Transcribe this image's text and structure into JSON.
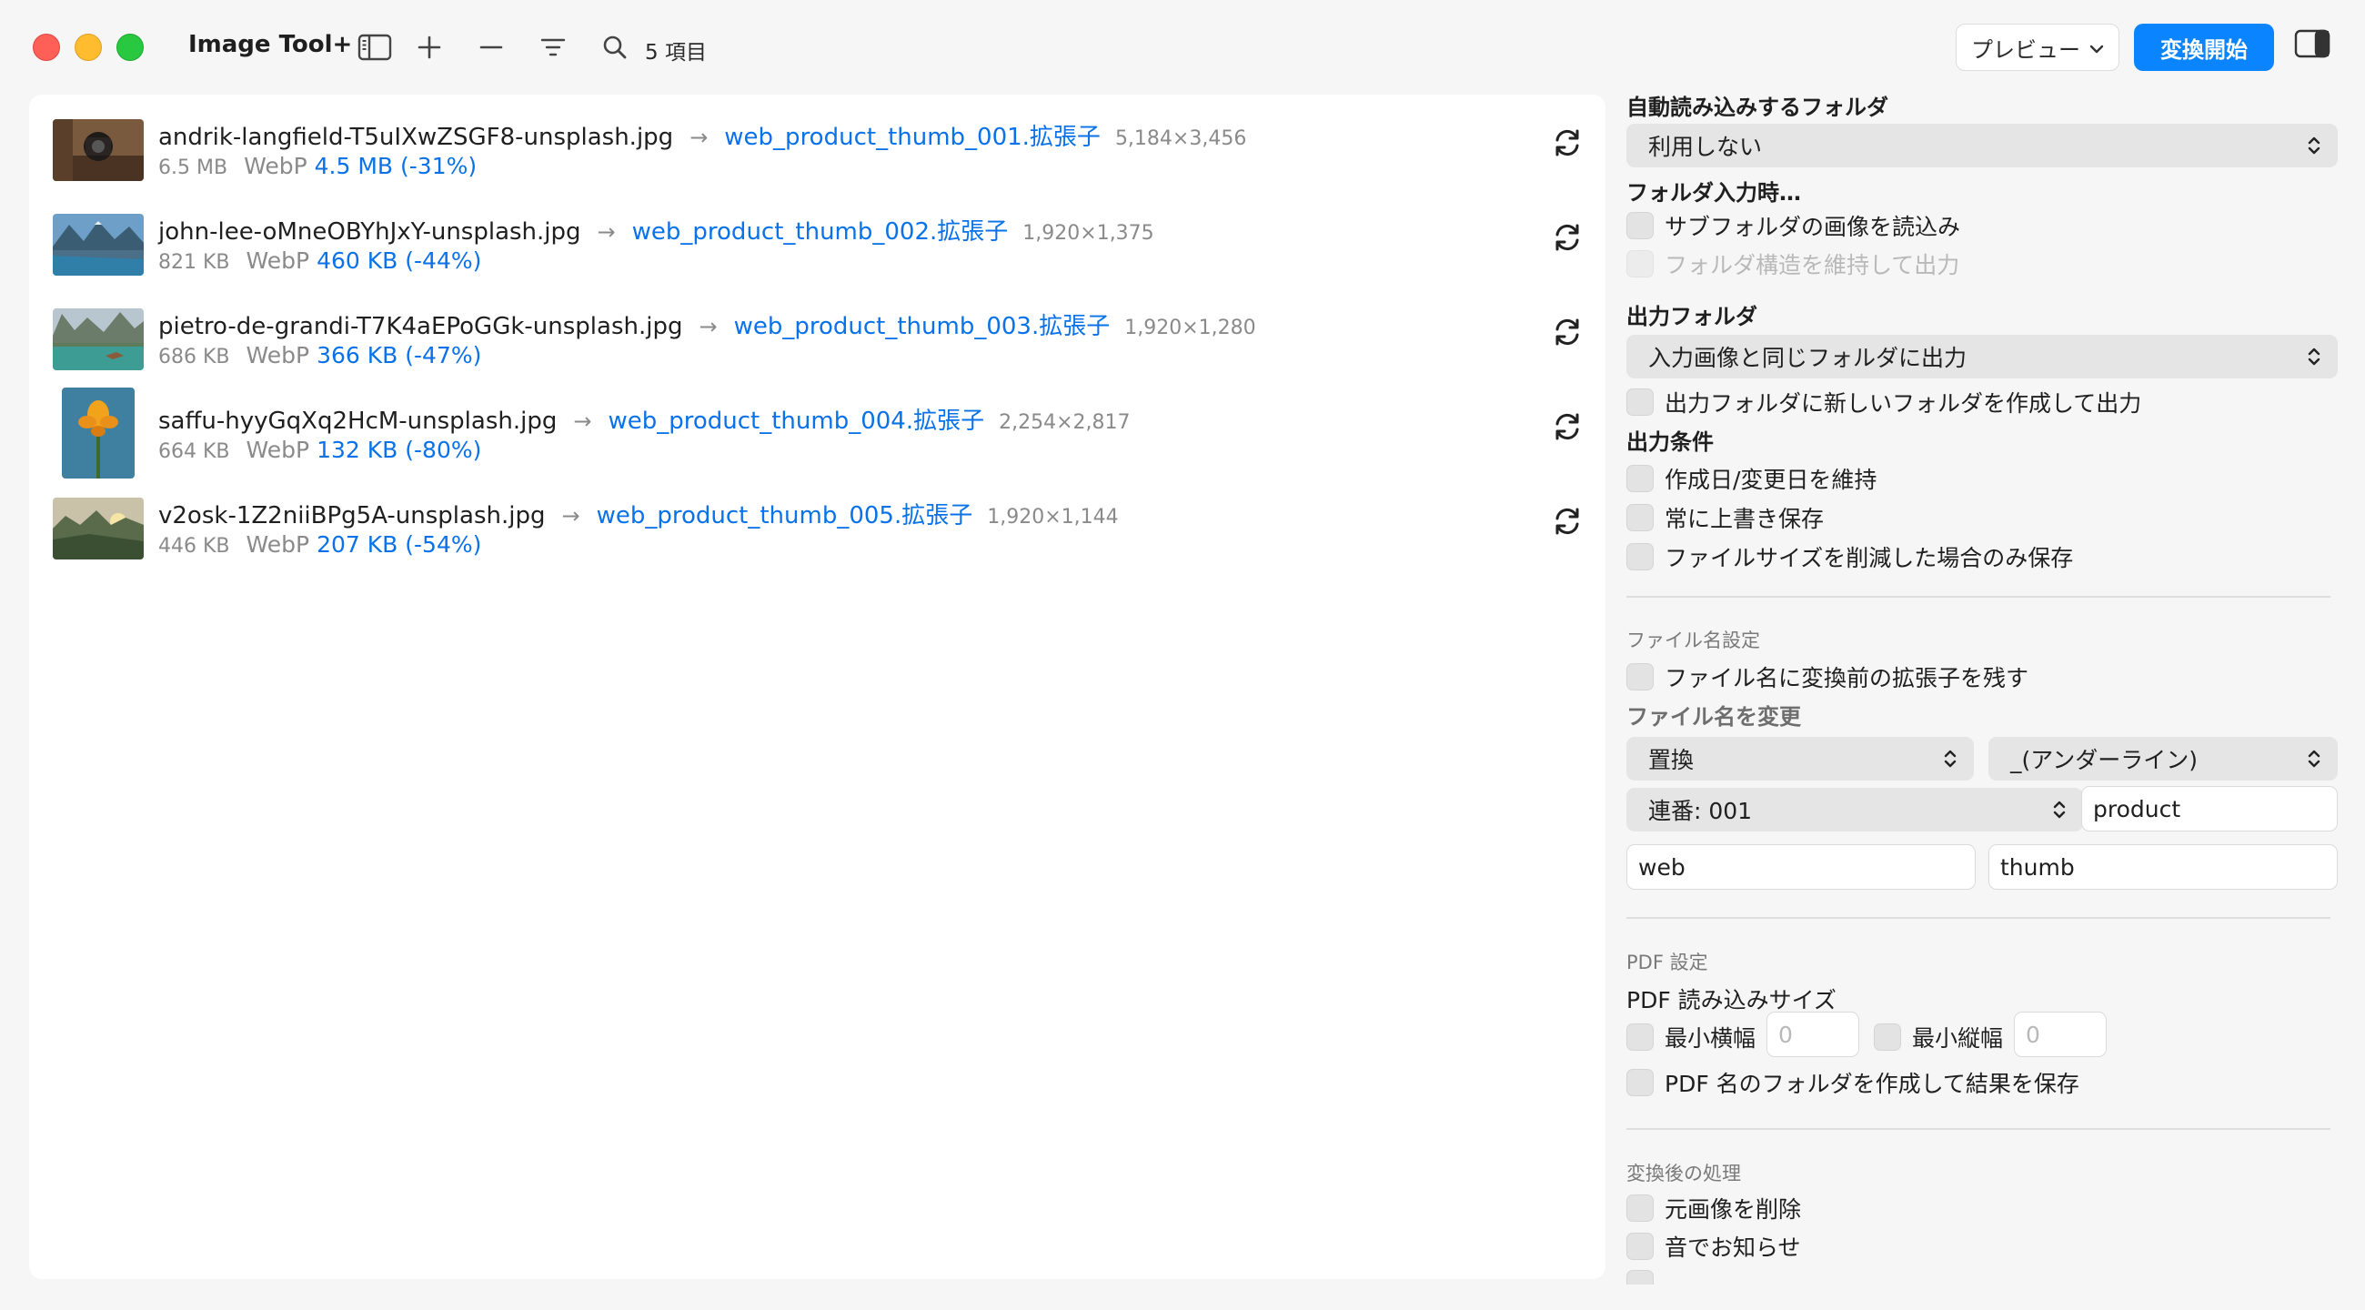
{
  "window": {
    "app_title": "Image Tool+",
    "item_count": "5 項目",
    "preview_label": "プレビュー",
    "convert_label": "変換開始",
    "accent_color": "#0a84ff"
  },
  "toolbar_icons": [
    "sidebar-icon",
    "plus-icon",
    "minus-icon",
    "filter-icon",
    "search-icon"
  ],
  "files": [
    {
      "source": "andrik-langfield-T5uIXwZSGF8-unsplash.jpg",
      "output": "web_product_thumb_001.拡張子",
      "dimensions": "5,184×3,456",
      "source_size": "6.5 MB",
      "format": "WebP",
      "output_size": "4.5 MB (-31%)"
    },
    {
      "source": "john-lee-oMneOBYhJxY-unsplash.jpg",
      "output": "web_product_thumb_002.拡張子",
      "dimensions": "1,920×1,375",
      "source_size": "821 KB",
      "format": "WebP",
      "output_size": "460 KB (-44%)"
    },
    {
      "source": "pietro-de-grandi-T7K4aEPoGGk-unsplash.jpg",
      "output": "web_product_thumb_003.拡張子",
      "dimensions": "1,920×1,280",
      "source_size": "686 KB",
      "format": "WebP",
      "output_size": "366 KB (-47%)"
    },
    {
      "source": "saffu-hyyGqXq2HcM-unsplash.jpg",
      "output": "web_product_thumb_004.拡張子",
      "dimensions": "2,254×2,817",
      "source_size": "664 KB",
      "format": "WebP",
      "output_size": "132 KB (-80%)"
    },
    {
      "source": "v2osk-1Z2niiBPg5A-unsplash.jpg",
      "output": "web_product_thumb_005.拡張子",
      "dimensions": "1,920×1,144",
      "source_size": "446 KB",
      "format": "WebP",
      "output_size": "207 KB (-54%)"
    }
  ],
  "settings": {
    "auto_folder": {
      "heading": "自動読み込みするフォルダ",
      "value": "利用しない"
    },
    "folder_input": {
      "heading": "フォルダ入力時…",
      "subfolders": "サブフォルダの画像を読込み",
      "keep_structure": "フォルダ構造を維持して出力"
    },
    "output_folder": {
      "heading": "出力フォルダ",
      "value": "入力画像と同じフォルダに出力",
      "new_folder": "出力フォルダに新しいフォルダを作成して出力"
    },
    "output_conditions": {
      "heading": "出力条件",
      "keep_dates": "作成日/変更日を維持",
      "always_overwrite": "常に上書き保存",
      "save_if_smaller": "ファイルサイズを削減した場合のみ保存"
    },
    "filename": {
      "subheading": "ファイル名設定",
      "keep_ext": "ファイル名に変換前の拡張子を残す",
      "rename_heading": "ファイル名を変更",
      "mode": "置換",
      "separator": "_(アンダーライン)",
      "sequence": "連番: 001",
      "text1": "product",
      "text2": "web",
      "text3": "thumb"
    },
    "pdf": {
      "subheading": "PDF 設定",
      "size_heading": "PDF 読み込みサイズ",
      "min_width_label": "最小横幅",
      "min_width_placeholder": "0",
      "min_height_label": "最小縦幅",
      "min_height_placeholder": "0",
      "folder_per_pdf": "PDF 名のフォルダを作成して結果を保存"
    },
    "post": {
      "subheading": "変換後の処理",
      "delete_original": "元画像を削除",
      "sound_notify": "音でお知らせ"
    }
  }
}
